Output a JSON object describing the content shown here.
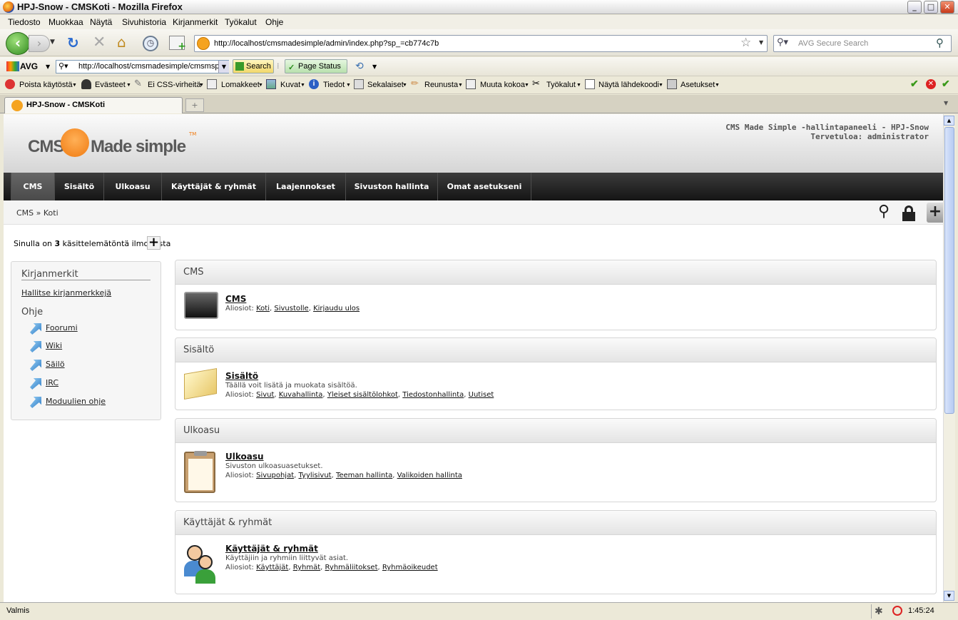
{
  "window": {
    "title": "HPJ-Snow - CMSKoti - Mozilla Firefox"
  },
  "menu": [
    "Tiedosto",
    "Muokkaa",
    "Näytä",
    "Sivuhistoria",
    "Kirjanmerkit",
    "Työkalut",
    "Ohje"
  ],
  "nav": {
    "url": "http://localhost/cmsmadesimple/admin/index.php?sp_=cb774c7b",
    "search_placeholder": "AVG Secure Search"
  },
  "avg": {
    "label": "AVG",
    "url": "http://localhost/cmsmadesimple/cmsmsp",
    "search_label": "Search",
    "page_status_label": "Page Status"
  },
  "devbar": [
    "Poista käytöstä",
    "Evästeet",
    "Ei CSS-virheitä",
    "Lomakkeet",
    "Kuvat",
    "Tiedot",
    "Sekalaiset",
    "Reunusta",
    "Muuta kokoa",
    "Työkalut",
    "Näytä lähdekoodi",
    "Asetukset"
  ],
  "tab": {
    "label": "HPJ-Snow - CMSKoti"
  },
  "cms": {
    "logo_text": "CMS Made Simple",
    "site_title": "CMS Made Simple -hallintapaneeli - HPJ-Snow",
    "welcome": "Tervetuloa: administrator",
    "nav": [
      "CMS",
      "Sisältö",
      "Ulkoasu",
      "Käyttäjät & ryhmät",
      "Laajennokset",
      "Sivuston hallinta",
      "Omat asetukseni"
    ],
    "breadcrumb": "CMS » Koti",
    "notification": {
      "prefix": "Sinulla on ",
      "count": "3",
      "suffix": " käsittelemätöntä ilmoitusta"
    },
    "sidebar": {
      "bookmarks_heading": "Kirjanmerkit",
      "manage_bookmarks": "Hallitse kirjanmerkkejä",
      "help_heading": "Ohje",
      "help_links": [
        "Foorumi",
        "Wiki",
        "Säilö",
        "IRC",
        "Moduulien ohje"
      ]
    },
    "sections": [
      {
        "heading": "CMS",
        "title": "CMS",
        "desc": "",
        "sub_label": "Aliosiot:",
        "subs": [
          "Koti",
          "Sivustolle",
          "Kirjaudu ulos"
        ]
      },
      {
        "heading": "Sisältö",
        "title": "Sisältö",
        "desc": "Täällä voit lisätä ja muokata sisältöä.",
        "sub_label": "Aliosiot:",
        "subs": [
          "Sivut",
          "Kuvahallinta",
          "Yleiset sisältölohkot",
          "Tiedostonhallinta",
          "Uutiset"
        ]
      },
      {
        "heading": "Ulkoasu",
        "title": "Ulkoasu",
        "desc": "Sivuston ulkoasuasetukset.",
        "sub_label": "Aliosiot:",
        "subs": [
          "Sivupohjat",
          "Tyylisivut",
          "Teeman hallinta",
          "Valikoiden hallinta"
        ]
      },
      {
        "heading": "Käyttäjät & ryhmät",
        "title": "Käyttäjät & ryhmät",
        "desc": "Käyttäjiin ja ryhmiin liittyvät asiat.",
        "sub_label": "Aliosiot:",
        "subs": [
          "Käyttäjät",
          "Ryhmät",
          "Ryhmäliitokset",
          "Ryhmäoikeudet"
        ]
      }
    ]
  },
  "status": {
    "text": "Valmis",
    "time": "1:45:24"
  }
}
